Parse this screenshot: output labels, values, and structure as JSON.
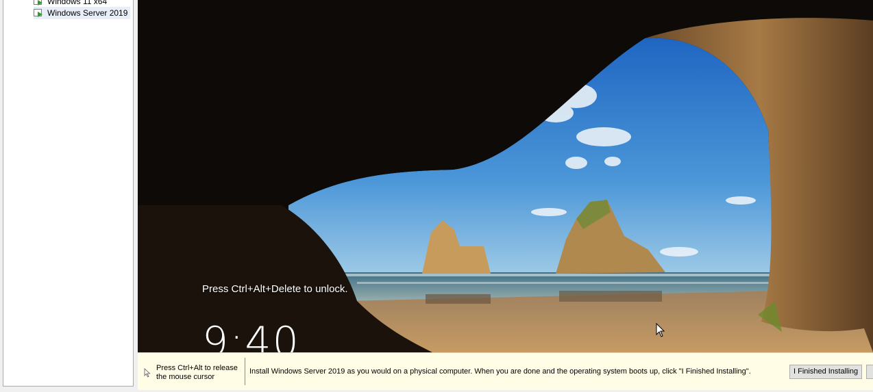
{
  "library": {
    "items": [
      {
        "label": "Windows 11 x64"
      },
      {
        "label": "Windows Server 2019",
        "selected": true
      }
    ]
  },
  "console": {
    "lock_hint": "Press Ctrl+Alt+Delete to unlock.",
    "clock": "9:40"
  },
  "hintbar": {
    "release_text": "Press Ctrl+Alt to release the mouse cursor",
    "install_text": "Install Windows Server 2019 as you would on a physical computer. When you are done and the operating system boots up, click \"I Finished Installing\".",
    "finish_button_label": "I Finished Installing"
  },
  "colors": {
    "hintbar_bg": "#fffde6",
    "sky": "#2f7fcf",
    "sand": "#b98a52"
  }
}
